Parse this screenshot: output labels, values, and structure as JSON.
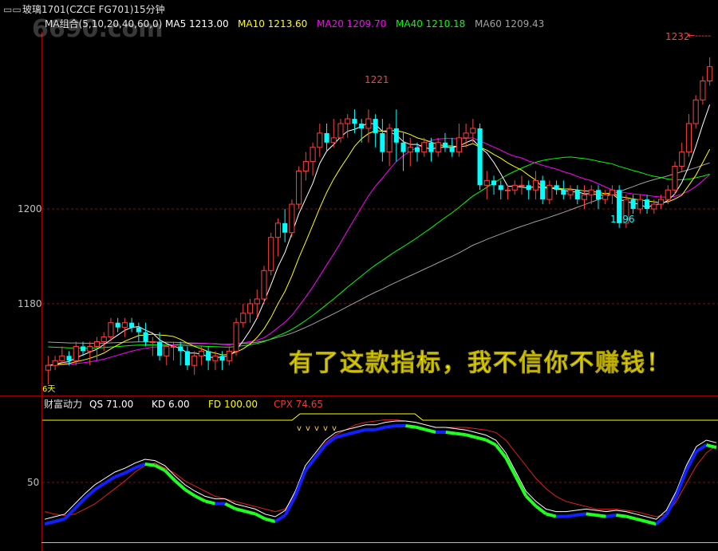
{
  "header": {
    "title": "玻璃1701(CZCE FG701)15分钟",
    "ma_group_label": "MA组合(5,10,20,40,60,0)",
    "ma_values": [
      {
        "label": "MA5",
        "value": "1213.00",
        "color": "#ffffff"
      },
      {
        "label": "MA10",
        "value": "1213.60",
        "color": "#ffff00"
      },
      {
        "label": "MA20",
        "value": "1209.70",
        "color": "#ff00ff"
      },
      {
        "label": "MA40",
        "value": "1210.18",
        "color": "#00ff00"
      },
      {
        "label": "MA60",
        "value": "1209.43",
        "color": "#a0a0a0"
      }
    ]
  },
  "watermark": "6690.com",
  "overlay_text": "有了这款指标，我不信你不赚钱！",
  "annotations": {
    "high_1221": "1221",
    "low_1196": "1196",
    "high_1232": "1232",
    "corner_label": "6天"
  },
  "indicator": {
    "name": "财富动力",
    "items": [
      {
        "label": "QS",
        "value": "71.00",
        "color": "#ffffff"
      },
      {
        "label": "KD",
        "value": "6.00",
        "color": "#ffffff"
      },
      {
        "label": "FD",
        "value": "100.00",
        "color": "#ffff00"
      },
      {
        "label": "CPX",
        "value": "74.65",
        "color": "#ff3030"
      }
    ],
    "marker_glyph": "v",
    "axis_label": "50"
  },
  "chart_data": {
    "type": "candlestick",
    "y_ticks": [
      1200,
      1180
    ],
    "ylim": [
      1163,
      1236
    ],
    "up_color": "#ff4040",
    "down_color": "#00ffff",
    "candles": [
      [
        1166,
        1169,
        1163,
        1167
      ],
      [
        1167,
        1169,
        1166,
        1168
      ],
      [
        1168,
        1171,
        1167,
        1169
      ],
      [
        1169,
        1170,
        1167,
        1168
      ],
      [
        1168,
        1172,
        1167,
        1171
      ],
      [
        1171,
        1172,
        1169,
        1170
      ],
      [
        1170,
        1172,
        1167,
        1171
      ],
      [
        1171,
        1173,
        1168,
        1172
      ],
      [
        1172,
        1174,
        1170,
        1173
      ],
      [
        1173,
        1177,
        1172,
        1176
      ],
      [
        1176,
        1177,
        1174,
        1175
      ],
      [
        1175,
        1177,
        1173,
        1176
      ],
      [
        1176,
        1177,
        1174,
        1175
      ],
      [
        1175,
        1176,
        1172,
        1174
      ],
      [
        1174,
        1176,
        1171,
        1172
      ],
      [
        1172,
        1173,
        1169,
        1172
      ],
      [
        1172,
        1174,
        1168,
        1169
      ],
      [
        1169,
        1171,
        1167,
        1171
      ],
      [
        1171,
        1172,
        1168,
        1171
      ],
      [
        1171,
        1172,
        1167,
        1170
      ],
      [
        1170,
        1171,
        1166,
        1167
      ],
      [
        1167,
        1170,
        1165,
        1169
      ],
      [
        1169,
        1171,
        1167,
        1170
      ],
      [
        1170,
        1171,
        1166,
        1168
      ],
      [
        1168,
        1170,
        1166,
        1169
      ],
      [
        1169,
        1170,
        1166,
        1168
      ],
      [
        1168,
        1171,
        1167,
        1170
      ],
      [
        1170,
        1177,
        1169,
        1176
      ],
      [
        1176,
        1180,
        1175,
        1178
      ],
      [
        1178,
        1181,
        1176,
        1180
      ],
      [
        1180,
        1183,
        1177,
        1181
      ],
      [
        1181,
        1188,
        1180,
        1187
      ],
      [
        1187,
        1195,
        1186,
        1194
      ],
      [
        1194,
        1198,
        1190,
        1197
      ],
      [
        1197,
        1200,
        1193,
        1195
      ],
      [
        1195,
        1202,
        1194,
        1201
      ],
      [
        1201,
        1209,
        1200,
        1208
      ],
      [
        1208,
        1212,
        1206,
        1210
      ],
      [
        1210,
        1214,
        1207,
        1213
      ],
      [
        1213,
        1218,
        1211,
        1216
      ],
      [
        1216,
        1218,
        1212,
        1214
      ],
      [
        1214,
        1219,
        1213,
        1215
      ],
      [
        1215,
        1219,
        1214,
        1218
      ],
      [
        1218,
        1220,
        1215,
        1219
      ],
      [
        1219,
        1221,
        1216,
        1218
      ],
      [
        1218,
        1219,
        1214,
        1217
      ],
      [
        1217,
        1221,
        1214,
        1219
      ],
      [
        1219,
        1220,
        1213,
        1216
      ],
      [
        1216,
        1219,
        1210,
        1212
      ],
      [
        1212,
        1218,
        1209,
        1217
      ],
      [
        1217,
        1221,
        1210,
        1214
      ],
      [
        1214,
        1216,
        1208,
        1212
      ],
      [
        1212,
        1215,
        1209,
        1213
      ],
      [
        1213,
        1214,
        1210,
        1212
      ],
      [
        1212,
        1215,
        1211,
        1214
      ],
      [
        1214,
        1215,
        1210,
        1212
      ],
      [
        1212,
        1215,
        1211,
        1214
      ],
      [
        1214,
        1216,
        1212,
        1213
      ],
      [
        1213,
        1215,
        1211,
        1212
      ],
      [
        1212,
        1218,
        1211,
        1215
      ],
      [
        1215,
        1218,
        1213,
        1216
      ],
      [
        1216,
        1219,
        1214,
        1217
      ],
      [
        1217,
        1218,
        1204,
        1205
      ],
      [
        1205,
        1208,
        1202,
        1206
      ],
      [
        1206,
        1207,
        1203,
        1205
      ],
      [
        1205,
        1206,
        1202,
        1204
      ],
      [
        1204,
        1205,
        1202,
        1204
      ],
      [
        1204,
        1206,
        1203,
        1205
      ],
      [
        1205,
        1207,
        1203,
        1205
      ],
      [
        1205,
        1206,
        1202,
        1204
      ],
      [
        1204,
        1208,
        1202,
        1206
      ],
      [
        1206,
        1207,
        1201,
        1202
      ],
      [
        1202,
        1206,
        1201,
        1205
      ],
      [
        1205,
        1206,
        1203,
        1204
      ],
      [
        1204,
        1206,
        1202,
        1203
      ],
      [
        1203,
        1205,
        1202,
        1204
      ],
      [
        1204,
        1205,
        1201,
        1202
      ],
      [
        1202,
        1205,
        1200,
        1203
      ],
      [
        1203,
        1205,
        1201,
        1204
      ],
      [
        1204,
        1205,
        1200,
        1202
      ],
      [
        1202,
        1204,
        1201,
        1203
      ],
      [
        1203,
        1205,
        1201,
        1204
      ],
      [
        1204,
        1205,
        1196,
        1197
      ],
      [
        1197,
        1203,
        1196,
        1202
      ],
      [
        1202,
        1203,
        1199,
        1200
      ],
      [
        1200,
        1203,
        1199,
        1202
      ],
      [
        1202,
        1203,
        1199,
        1200
      ],
      [
        1200,
        1202,
        1199,
        1201
      ],
      [
        1201,
        1203,
        1200,
        1202
      ],
      [
        1202,
        1205,
        1201,
        1204
      ],
      [
        1204,
        1210,
        1203,
        1209
      ],
      [
        1209,
        1214,
        1208,
        1212
      ],
      [
        1212,
        1220,
        1211,
        1218
      ],
      [
        1218,
        1224,
        1217,
        1223
      ],
      [
        1223,
        1228,
        1222,
        1227
      ],
      [
        1227,
        1232,
        1226,
        1230
      ]
    ],
    "ma_colors": {
      "MA5": "#ffffff",
      "MA10": "#ffff00",
      "MA20": "#ff00ff",
      "MA40": "#00ff00",
      "MA60": "#a0a0a0"
    },
    "ma60_start": 1172,
    "ma40_start": 1171,
    "sub_ylim": [
      0,
      100
    ],
    "sub_series": {
      "white": [
        18,
        20,
        22,
        30,
        38,
        45,
        50,
        55,
        58,
        62,
        65,
        64,
        60,
        52,
        45,
        40,
        36,
        34,
        34,
        30,
        28,
        26,
        22,
        20,
        25,
        40,
        60,
        70,
        80,
        86,
        88,
        90,
        92,
        92,
        94,
        95,
        95,
        94,
        92,
        90,
        90,
        89,
        88,
        86,
        84,
        80,
        70,
        55,
        40,
        32,
        26,
        24,
        24,
        25,
        26,
        25,
        24,
        25,
        24,
        22,
        20,
        18,
        25,
        40,
        60,
        75,
        80,
        78
      ],
      "red": [
        24,
        22,
        21,
        22,
        26,
        30,
        36,
        42,
        48,
        55,
        60,
        62,
        58,
        54,
        48,
        44,
        40,
        36,
        34,
        32,
        30,
        28,
        26,
        24,
        26,
        38,
        54,
        68,
        78,
        84,
        88,
        92,
        94,
        95,
        96,
        96,
        95,
        94,
        92,
        90,
        90,
        90,
        90,
        89,
        88,
        86,
        80,
        70,
        60,
        50,
        42,
        36,
        32,
        30,
        28,
        26,
        26,
        26,
        25,
        24,
        22,
        20,
        22,
        32,
        46,
        60,
        70,
        76
      ]
    }
  }
}
